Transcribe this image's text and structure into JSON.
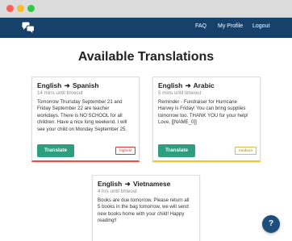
{
  "navbar": {
    "links": [
      "FAQ",
      "My Profile",
      "Logout"
    ],
    "background": "#16416b"
  },
  "page": {
    "title": "Available Translations"
  },
  "cards": [
    {
      "from": "English",
      "to": "Spanish",
      "timeout": "14 mins until timeout",
      "text": "Tomorrow Thursday September 21 and Friday September 22 are teacher workdays. There is NO SCHOOL for all children. Have a nice long weekend. I will see your child on Monday September 25.",
      "button": "Translate",
      "priority": "highest",
      "accent": "#e0524a"
    },
    {
      "from": "English",
      "to": "Arabic",
      "timeout": "5 mins until timeout",
      "text": "Reminder - Fundraiser for Hurricane Harvey is Friday! You can bring supplies tomorrow too. THANK YOU for your help! Love, [[NAME_0]]",
      "button": "Translate",
      "priority": "medium",
      "accent": "#e6c63c"
    },
    {
      "from": "English",
      "to": "Vietnamese",
      "timeout": "4 hrs until timeout",
      "text": "Books are due tomorrow. Please return all 5 books in the bag tomorrow, we will send new books home with your child! Happy reading!!"
    }
  ],
  "help": {
    "label": "?"
  },
  "icons": {
    "logo": "chat-bubbles-icon",
    "arrow": "arrow-right-icon"
  }
}
